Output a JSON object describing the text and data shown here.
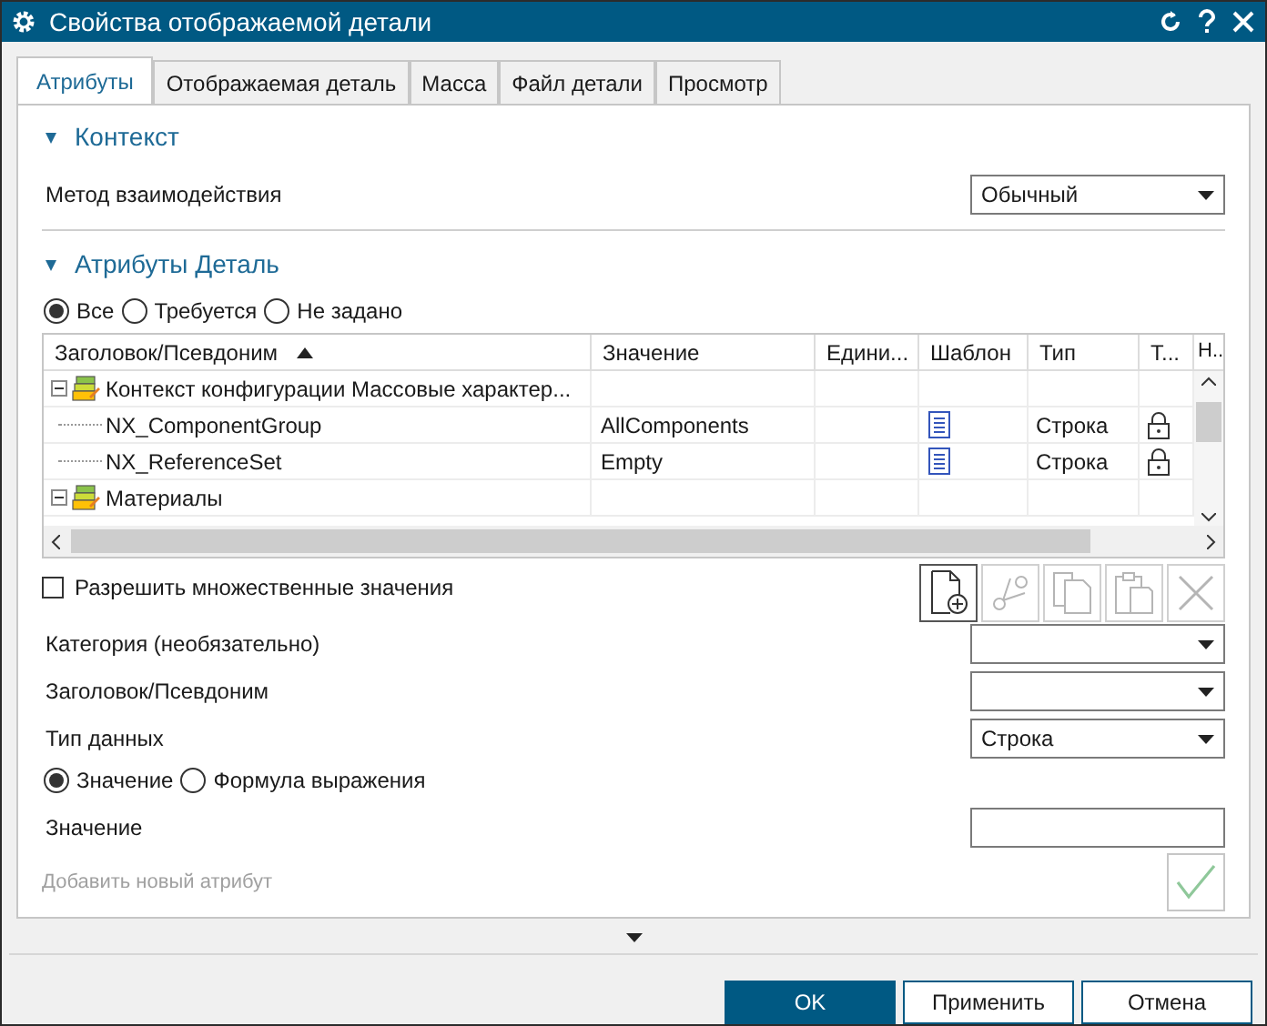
{
  "window": {
    "title": "Свойства отображаемой детали"
  },
  "tabs": [
    {
      "label": "Атрибуты",
      "selected": true
    },
    {
      "label": "Отображаемая деталь",
      "selected": false
    },
    {
      "label": "Масса",
      "selected": false
    },
    {
      "label": "Файл детали",
      "selected": false
    },
    {
      "label": "Просмотр",
      "selected": false
    }
  ],
  "context": {
    "title": "Контекст",
    "expanded": true,
    "method_label": "Метод взаимодействия",
    "method_value": "Обычный"
  },
  "attributes": {
    "title": "Атрибуты Деталь",
    "expanded": true,
    "filters": [
      {
        "label": "Все",
        "selected": true
      },
      {
        "label": "Требуется",
        "selected": false
      },
      {
        "label": "Не задано",
        "selected": false
      }
    ],
    "table": {
      "columns": [
        "Заголовок/Псевдоним",
        "Значение",
        "Едини...",
        "Шаблон",
        "Тип",
        "Т...",
        "Н..."
      ],
      "rows": [
        {
          "title": "Контекст конфигурации Массовые характер...",
          "expanded": true,
          "children": [
            {
              "title": "NX_ComponentGroup",
              "value": "AllComponents",
              "template": true,
              "type": "Строка",
              "locked": true
            },
            {
              "title": "NX_ReferenceSet",
              "value": "Empty",
              "template": true,
              "type": "Строка",
              "locked": true
            }
          ]
        },
        {
          "title": "Материалы",
          "expanded": true
        }
      ]
    },
    "multi_values": {
      "label": "Разрешить множественные значения",
      "checked": false
    },
    "toolbar": [
      {
        "kind": "new",
        "disabled": false
      },
      {
        "kind": "cut",
        "disabled": true
      },
      {
        "kind": "copy",
        "disabled": true
      },
      {
        "kind": "paste",
        "disabled": true
      },
      {
        "kind": "delete",
        "disabled": true
      }
    ],
    "fields": [
      {
        "label": "Категория (необязательно)",
        "kind": "dropdown"
      },
      {
        "label": "Заголовок/Псевдоним",
        "kind": "dropdown"
      },
      {
        "label": "Тип данных",
        "kind": "dropdown",
        "value": "Строка"
      }
    ],
    "value_modes": [
      {
        "label": "Значение",
        "selected": true
      },
      {
        "label": "Формула выражения",
        "selected": false
      }
    ],
    "value_field": {
      "label": "Значение"
    },
    "add": {
      "label": "Добавить новый атрибут",
      "disabled": true
    }
  },
  "buttons": [
    {
      "label": "OK",
      "primary": true
    },
    {
      "label": "Применить",
      "primary": false
    },
    {
      "label": "Отмена",
      "primary": false
    }
  ]
}
